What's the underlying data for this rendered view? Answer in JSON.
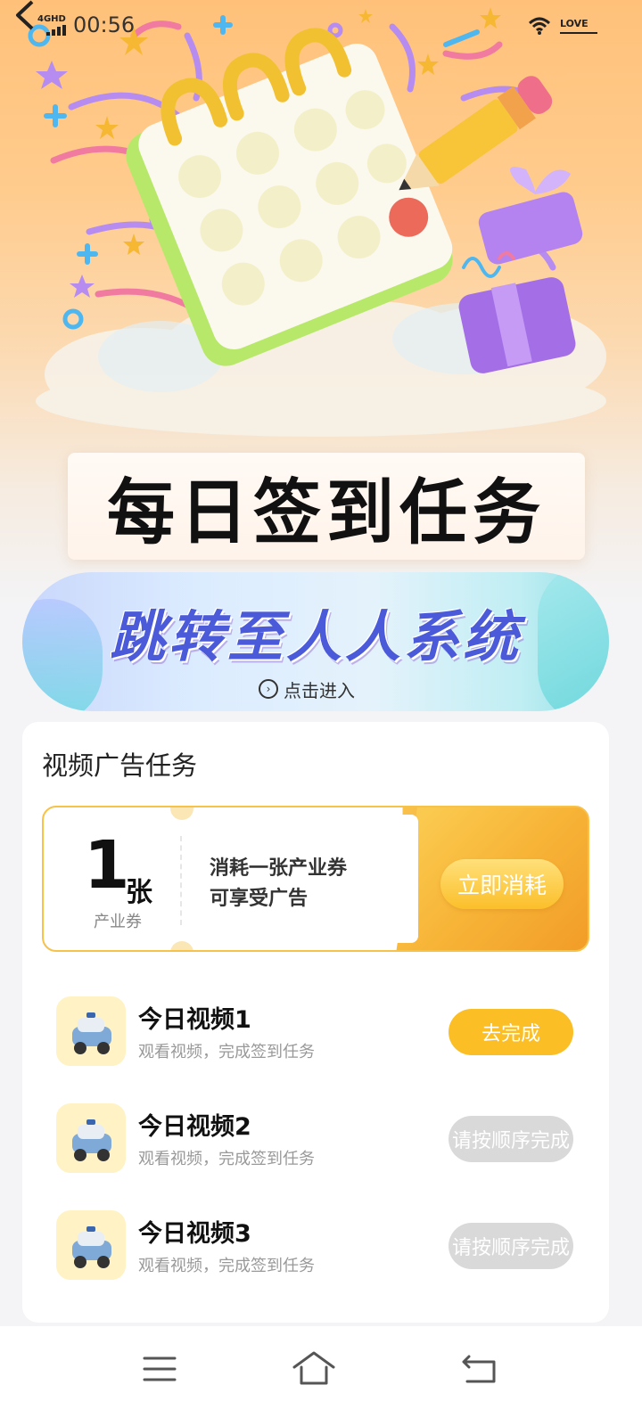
{
  "status": {
    "network": "4GHD",
    "time": "00:56",
    "battery_text": "LOVE"
  },
  "hero": {
    "title": "每日签到任务"
  },
  "banner": {
    "title": "跳转至人人系统",
    "enter": "点击进入"
  },
  "card": {
    "title": "视频广告任务",
    "coupon": {
      "count": "1",
      "unit": "张",
      "unit_sub": "产业券",
      "desc_line1": "消耗一张产业券",
      "desc_line2": "可享受广告",
      "button": "立即消耗"
    },
    "tasks": [
      {
        "name": "今日视频1",
        "desc": "观看视频，完成签到任务",
        "action": "去完成"
      },
      {
        "name": "今日视频2",
        "desc": "观看视频，完成签到任务",
        "action": "请按顺序完成"
      },
      {
        "name": "今日视频3",
        "desc": "观看视频，完成签到任务",
        "action": "请按顺序完成"
      }
    ]
  },
  "colors": {
    "accent": "#fbbe25",
    "disabled": "#d9d9d9",
    "banner_text": "#4a5ad8"
  },
  "icons": [
    "back-icon",
    "signal-icon",
    "wifi-icon",
    "battery-icon",
    "calendar-illustration",
    "pencil-illustration",
    "gift-illustration",
    "car-icon",
    "menu-icon",
    "home-icon",
    "back-nav-icon"
  ]
}
